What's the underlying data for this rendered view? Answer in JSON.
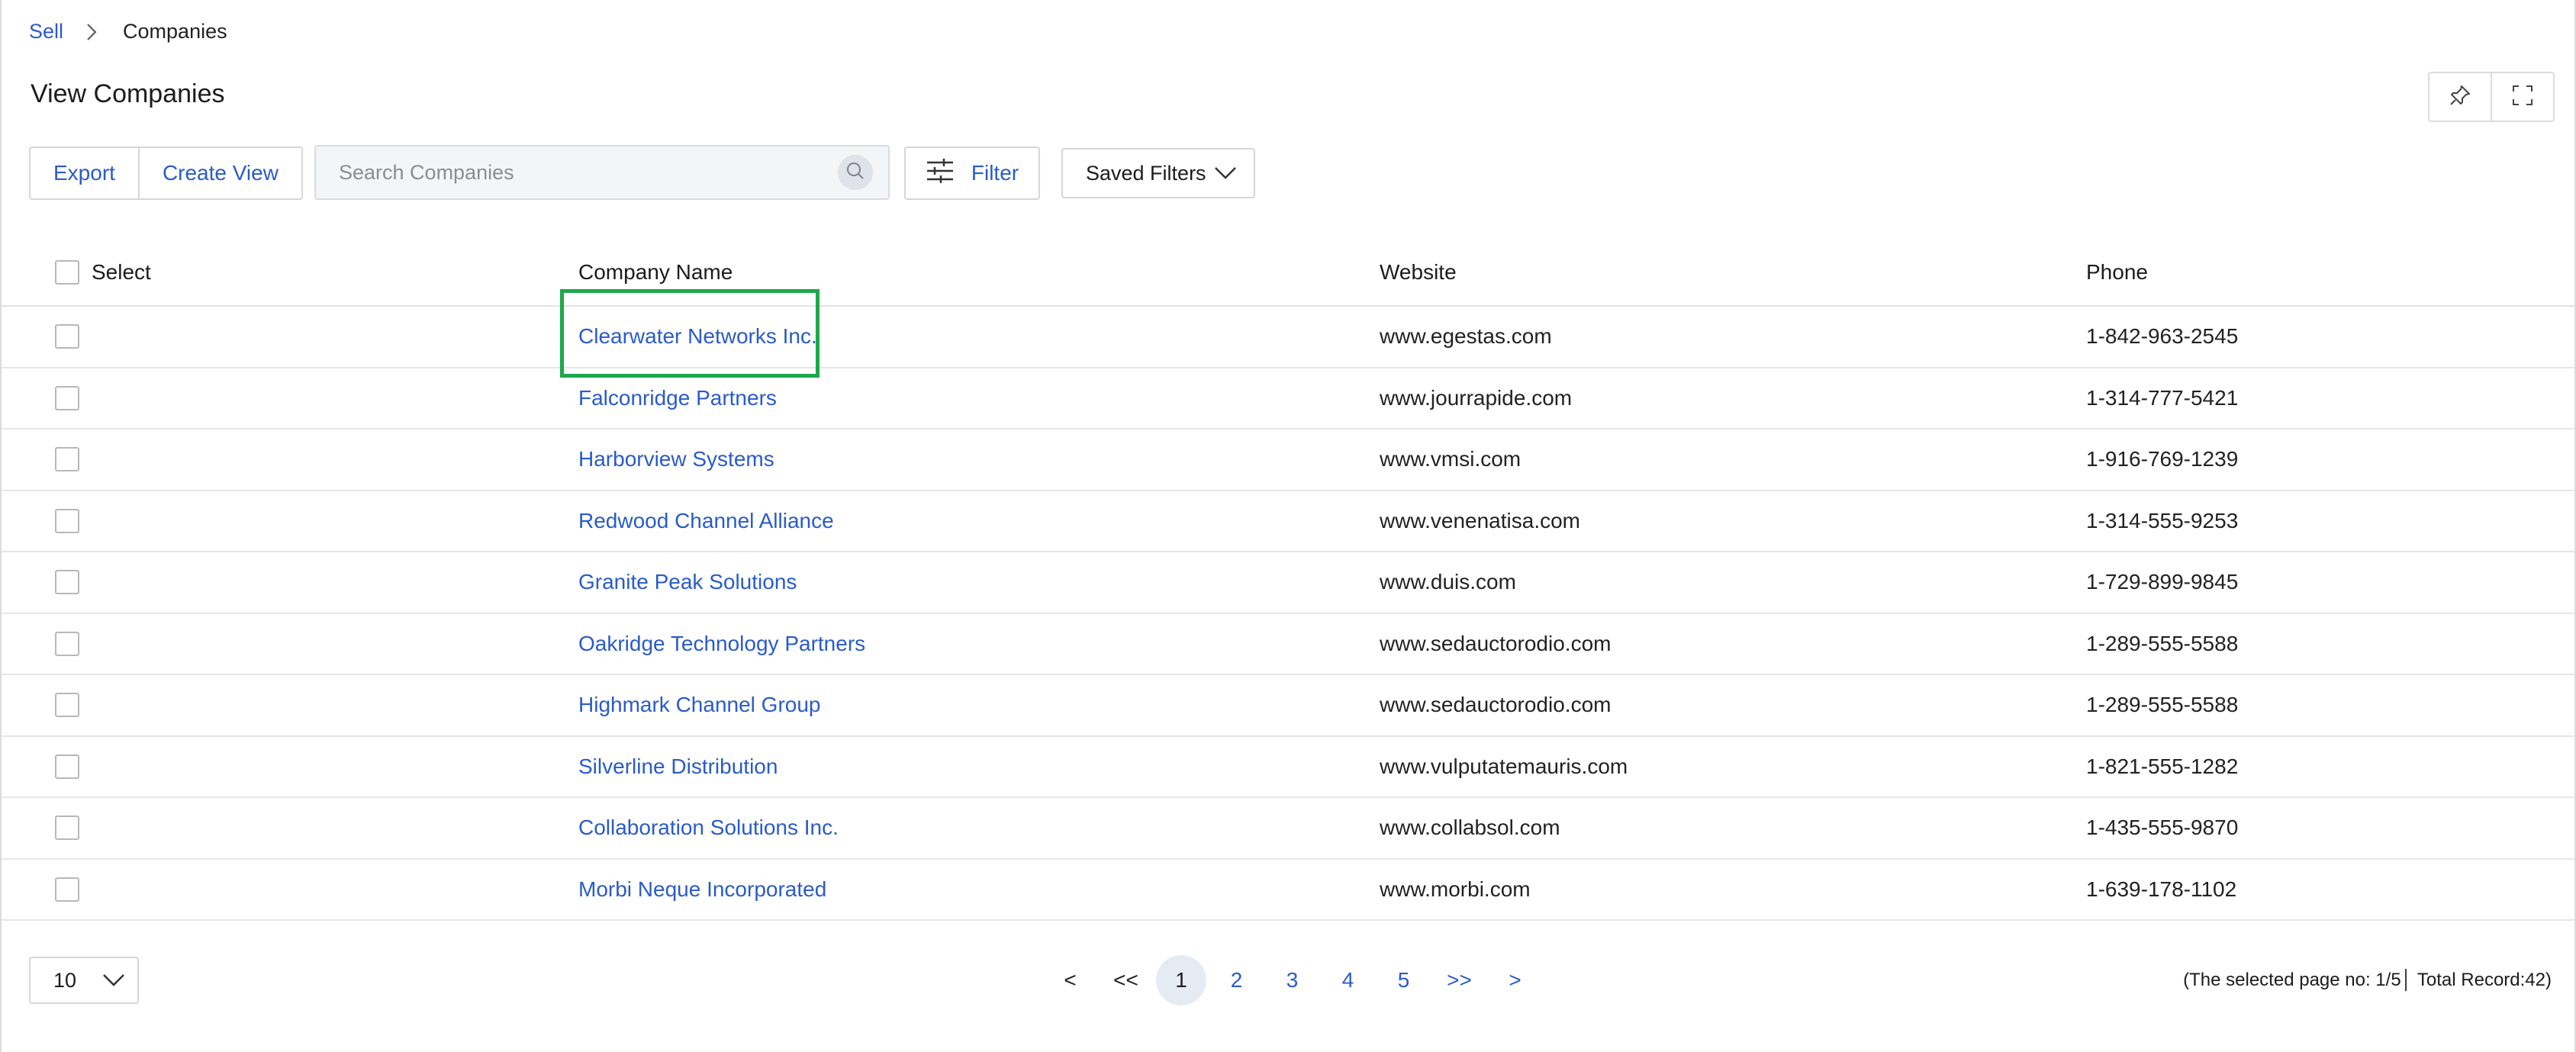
{
  "breadcrumb": {
    "root": "Sell",
    "current": "Companies"
  },
  "page": {
    "title": "View Companies"
  },
  "toolbar": {
    "export_label": "Export",
    "create_view_label": "Create View",
    "search_placeholder": "Search Companies",
    "search_value": "",
    "filter_label": "Filter",
    "saved_filters_label": "Saved Filters"
  },
  "table": {
    "headers": {
      "select": "Select",
      "name": "Company Name",
      "website": "Website",
      "phone": "Phone"
    },
    "rows": [
      {
        "name": "Clearwater Networks Inc.",
        "website": "www.egestas.com",
        "phone": "1-842-963-2545",
        "selected": false
      },
      {
        "name": "Falconridge Partners",
        "website": "www.jourrapide.com",
        "phone": "1-314-777-5421",
        "selected": false
      },
      {
        "name": "Harborview Systems",
        "website": "www.vmsi.com",
        "phone": "1-916-769-1239",
        "selected": false
      },
      {
        "name": "Redwood Channel Alliance",
        "website": "www.venenatisa.com",
        "phone": "1-314-555-9253",
        "selected": false
      },
      {
        "name": "Granite Peak Solutions",
        "website": "www.duis.com",
        "phone": "1-729-899-9845",
        "selected": false
      },
      {
        "name": "Oakridge Technology Partners",
        "website": "www.sedauctorodio.com",
        "phone": "1-289-555-5588",
        "selected": false
      },
      {
        "name": "Highmark Channel Group",
        "website": "www.sedauctorodio.com",
        "phone": "1-289-555-5588",
        "selected": false
      },
      {
        "name": "Silverline Distribution",
        "website": "www.vulputatemauris.com",
        "phone": "1-821-555-1282",
        "selected": false
      },
      {
        "name": "Collaboration Solutions Inc.",
        "website": "www.collabsol.com",
        "phone": "1-435-555-9870",
        "selected": false
      },
      {
        "name": "Morbi Neque Incorporated",
        "website": "www.morbi.com",
        "phone": "1-639-178-1102",
        "selected": false
      }
    ]
  },
  "pagination": {
    "page_size": "10",
    "prev": "<",
    "first": "<<",
    "pages": [
      "1",
      "2",
      "3",
      "4",
      "5"
    ],
    "active_page": "1",
    "last": ">>",
    "next": ">",
    "status": "(The selected page no: 1/5│ Total Record:42)"
  },
  "colors": {
    "link": "#2a5bc9",
    "highlight": "#1ea84a"
  },
  "icons": {
    "breadcrumb_separator": "chevron-right-icon",
    "pin": "pin-icon",
    "fullscreen": "fullscreen-icon",
    "search": "search-icon",
    "filter": "sliders-icon",
    "dropdown": "chevron-down-icon"
  }
}
